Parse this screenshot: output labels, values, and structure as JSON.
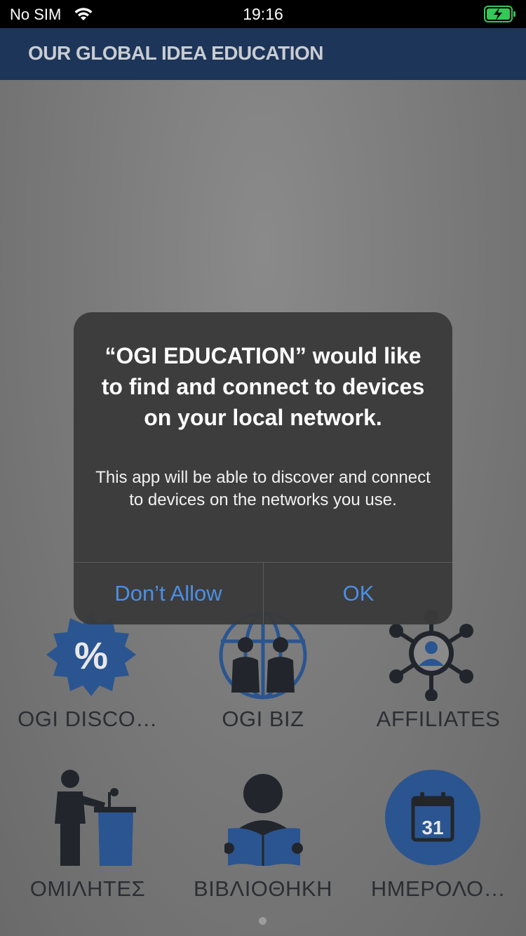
{
  "status_bar": {
    "carrier": "No SIM",
    "time": "19:16"
  },
  "header": {
    "title": "OUR GLOBAL IDEA EDUCATION"
  },
  "grid": {
    "tiles": [
      {
        "label": "OGI DISCO…",
        "icon": "discount-badge-icon"
      },
      {
        "label": "OGI BIZ",
        "icon": "business-handshake-globe-icon"
      },
      {
        "label": "AFFILIATES",
        "icon": "network-user-icon"
      },
      {
        "label": "ΟΜΙΛΗΤΕΣ",
        "icon": "speaker-podium-icon"
      },
      {
        "label": "ΒΙΒΛΙΟΘΗΚΗ",
        "icon": "reader-book-icon"
      },
      {
        "label": "ΗΜΕΡΟΛΟ…",
        "icon": "calendar-icon"
      }
    ],
    "calendar_day": "31",
    "discount_symbol": "%"
  },
  "alert": {
    "title": "“OGI EDUCATION” would like to find and connect to devices on your local network.",
    "message": "This app will be able to discover and connect to devices on the networks you use.",
    "buttons": {
      "deny": "Don’t Allow",
      "ok": "OK"
    }
  },
  "colors": {
    "header_bg": "#1c3558",
    "icon_dark": "#22262c",
    "icon_blue": "#2a5590",
    "alert_button": "#4b8fe6"
  }
}
